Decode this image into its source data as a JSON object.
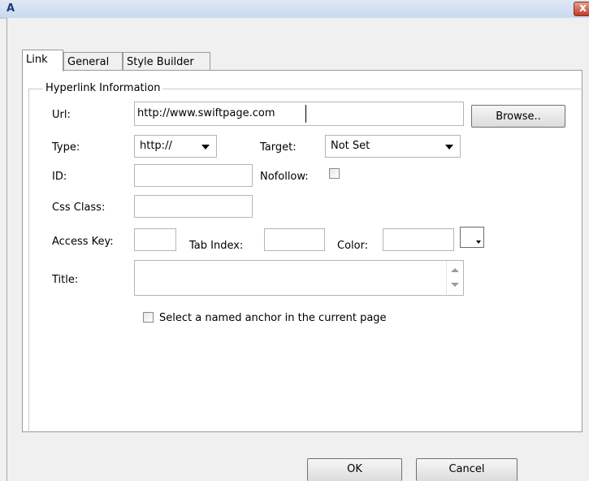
{
  "window": {
    "title": "A",
    "close_label": "x"
  },
  "tabs": [
    "Link",
    "General",
    "Style Builder"
  ],
  "fieldset": {
    "legend": "Hyperlink Information"
  },
  "form": {
    "url_label": "Url:",
    "url_value": "http://www.swiftpage.com",
    "browse_label": "Browse..",
    "type_label": "Type:",
    "type_value": "http://",
    "target_label": "Target:",
    "target_value": "Not Set",
    "id_label": "ID:",
    "nofollow_label": "Nofollow:",
    "nofollow_checked": false,
    "css_class_label": "Css Class:",
    "access_key_label": "Access Key:",
    "tab_index_label": "Tab Index:",
    "color_label": "Color:",
    "title_label": "Title:",
    "anchor_checkbox_label": "Select a named anchor in the current page",
    "anchor_checked": false
  },
  "footer": {
    "ok_label": "OK",
    "cancel_label": "Cancel"
  },
  "colors": {
    "titlebar": "#c9d9ee",
    "close": "#c0392b",
    "panel": "#ffffff",
    "background": "#f0f0f0"
  }
}
